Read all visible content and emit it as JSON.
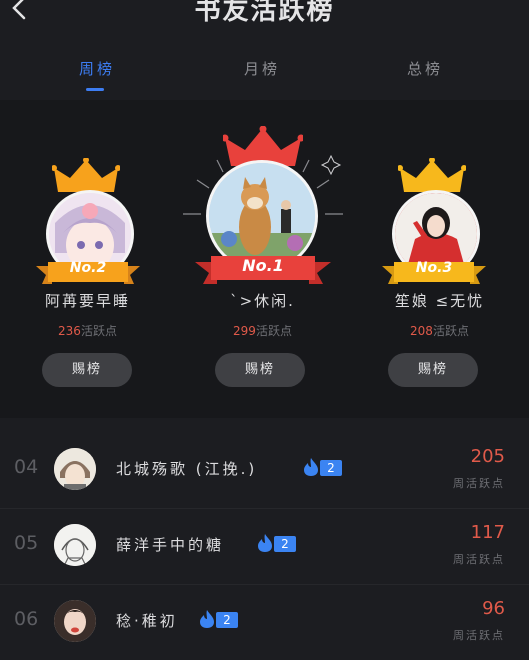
{
  "header": {
    "title": "书友活跃榜"
  },
  "tabs": [
    {
      "label": "周榜",
      "active": true
    },
    {
      "label": "月榜",
      "active": false
    },
    {
      "label": "总榜",
      "active": false
    }
  ],
  "podium": {
    "first": {
      "rank_label": "No.1",
      "name": "`>休闲.",
      "score": "299",
      "score_suffix": "活跃点",
      "button": "赐榜"
    },
    "second": {
      "rank_label": "No.2",
      "name": "阿苒要早睡",
      "score": "236",
      "score_suffix": "活跃点",
      "button": "赐榜"
    },
    "third": {
      "rank_label": "No.3",
      "name": "笙娘 ≤无忧",
      "score": "208",
      "score_suffix": "活跃点",
      "button": "赐榜"
    }
  },
  "list": [
    {
      "rank": "04",
      "name": "北城殇歌 (江挽.)",
      "level": "2",
      "score": "205",
      "score_label": "周活跃点"
    },
    {
      "rank": "05",
      "name": "薛洋手中的糖",
      "level": "2",
      "score": "117",
      "score_label": "周活跃点"
    },
    {
      "rank": "06",
      "name": "稔·稚初",
      "level": "2",
      "score": "96",
      "score_label": "周活跃点"
    }
  ],
  "colors": {
    "accent": "#3d7df2",
    "score": "#e05a4a",
    "crown": "#f7a21c",
    "ribbon_first": "#e8413c"
  }
}
